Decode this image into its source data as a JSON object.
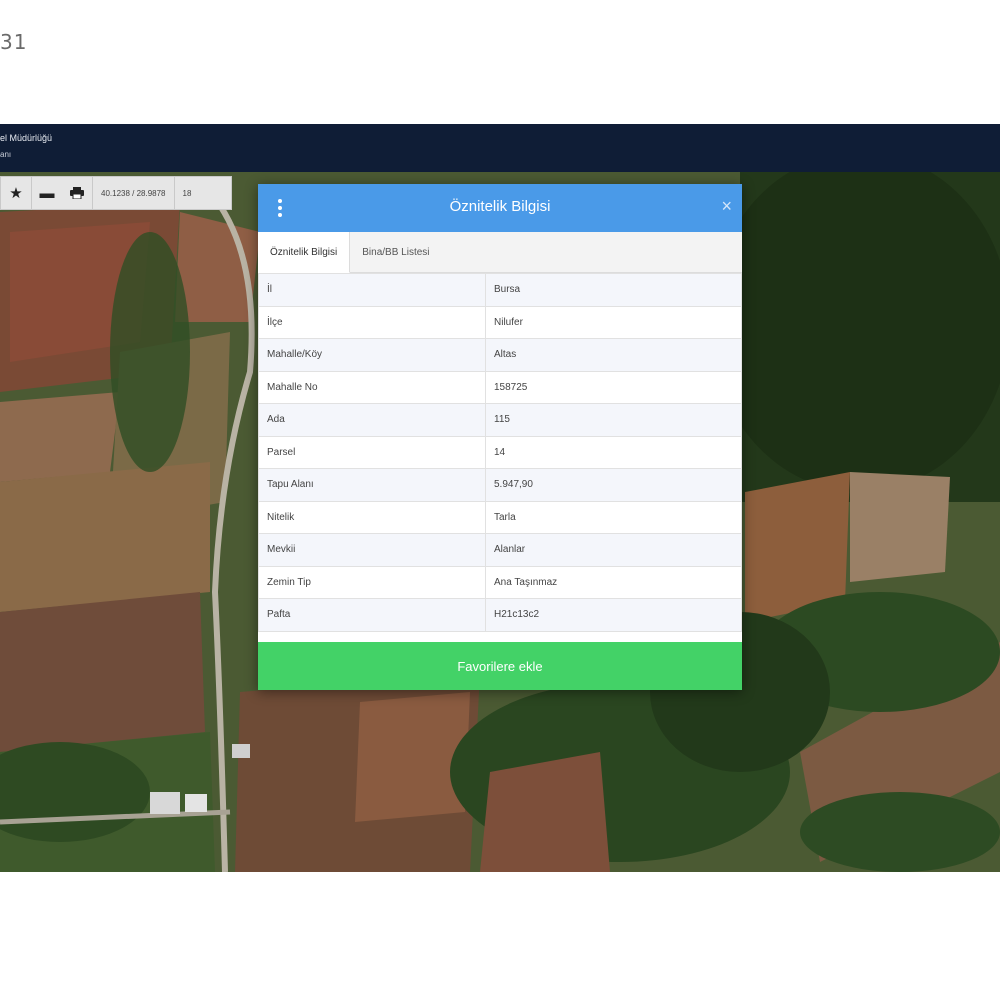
{
  "corner_label": "31",
  "app": {
    "header_line1": "el Müdürlüğü",
    "header_line2": "anı"
  },
  "toolbar": {
    "star_icon": "star-icon",
    "minus_icon": "minus-icon",
    "print_icon": "print-icon",
    "coordinates": "40.1238 / 28.9878",
    "zoom": "18"
  },
  "dialog": {
    "title": "Öznitelik Bilgisi",
    "close_glyph": "×",
    "tabs": [
      {
        "label": "Öznitelik Bilgisi",
        "active": true
      },
      {
        "label": "Bina/BB Listesi",
        "active": false
      }
    ],
    "rows": [
      {
        "key": "İl",
        "value": "Bursa"
      },
      {
        "key": "İlçe",
        "value": "Nilufer"
      },
      {
        "key": "Mahalle/Köy",
        "value": "Altas"
      },
      {
        "key": "Mahalle No",
        "value": "158725"
      },
      {
        "key": "Ada",
        "value": "115"
      },
      {
        "key": "Parsel",
        "value": "14"
      },
      {
        "key": "Tapu Alanı",
        "value": "5.947,90"
      },
      {
        "key": "Nitelik",
        "value": "Tarla"
      },
      {
        "key": "Mevkii",
        "value": "Alanlar"
      },
      {
        "key": "Zemin Tip",
        "value": "Ana Taşınmaz"
      },
      {
        "key": "Pafta",
        "value": "H21c13c2"
      }
    ],
    "favorite_button": "Favorilere ekle"
  },
  "colors": {
    "header_bg": "#0f1d36",
    "dialog_header": "#4a9ae8",
    "favorite_button": "#43d267"
  }
}
